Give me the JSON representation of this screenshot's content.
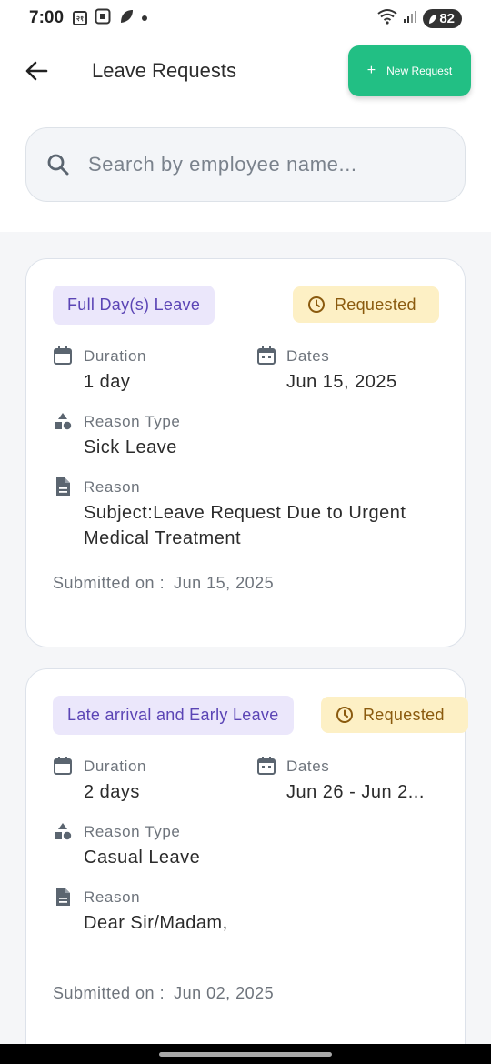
{
  "status_bar": {
    "time": "7:00",
    "icon_text": "२१",
    "battery": "82",
    "icons": [
      "notification-icon",
      "screenshot-icon",
      "leaf-icon",
      "dot-icon",
      "wifi-icon",
      "signal-icon",
      "battery-icon"
    ]
  },
  "header": {
    "title": "Leave Requests",
    "new_request_label": "New Request",
    "new_request_color": "#22bf84"
  },
  "search": {
    "placeholder": "Search by employee name..."
  },
  "labels": {
    "duration": "Duration",
    "dates": "Dates",
    "reason_type": "Reason Type",
    "reason": "Reason",
    "submitted_on": "Submitted on :"
  },
  "requests": [
    {
      "type": "Full Day(s) Leave",
      "status": "Requested",
      "duration": "1 day",
      "dates": "Jun 15, 2025",
      "reason_type": "Sick Leave",
      "reason": "Subject:Leave Request Due to Urgent Medical Treatment",
      "submitted_on": "Jun 15, 2025"
    },
    {
      "type": "Late arrival and Early Leave",
      "status": "Requested",
      "duration": "2 days",
      "dates": "Jun 26 - Jun 2...",
      "reason_type": "Casual Leave",
      "reason": "Dear Sir/Madam,",
      "submitted_on": "Jun 02, 2025"
    }
  ],
  "colors": {
    "type_badge_bg": "#ebe7fb",
    "type_badge_text": "#5b45b5",
    "status_badge_bg": "#fdf0c5",
    "status_badge_text": "#8a5a0e"
  }
}
